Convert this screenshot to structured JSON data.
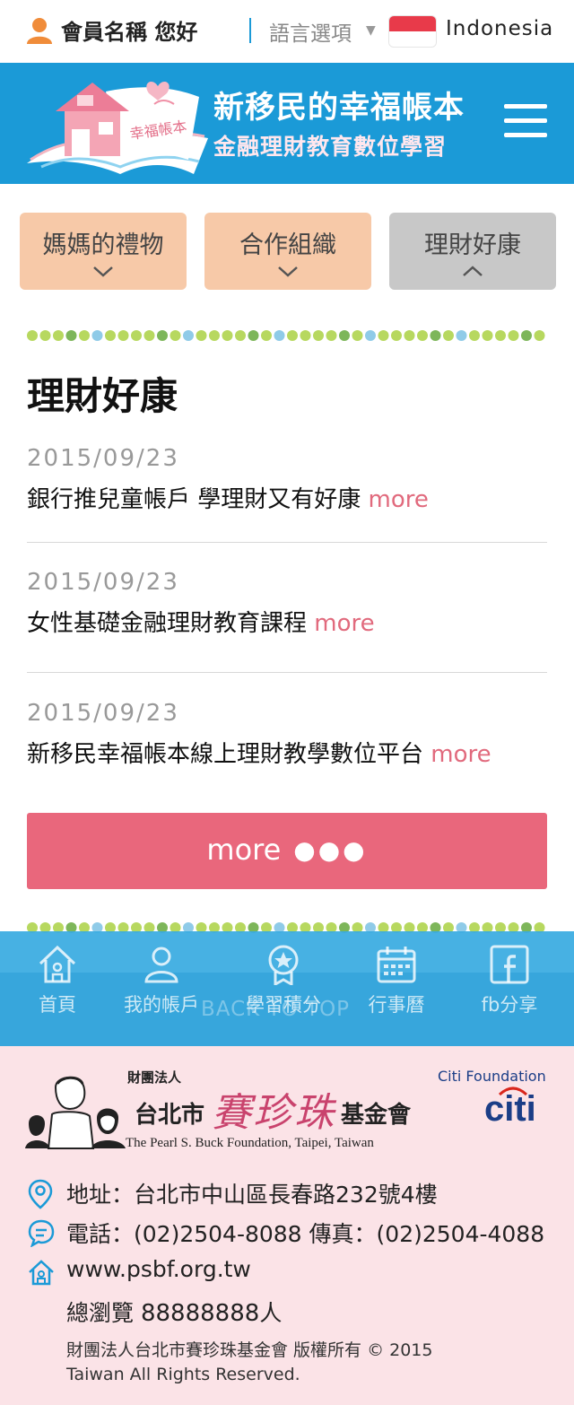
{
  "topbar": {
    "username": "會員名稱 您好",
    "language_label": "語言選項",
    "language_value": "Indonesia"
  },
  "header": {
    "title": "新移民的幸福帳本",
    "subtitle": "金融理財教育數位學習",
    "logo_text": "幸福帳本"
  },
  "tabs": [
    {
      "label": "媽媽的禮物",
      "state": "collapsed"
    },
    {
      "label": "合作組織",
      "state": "collapsed"
    },
    {
      "label": "理財好康",
      "state": "expanded"
    }
  ],
  "section": {
    "title": "理財好康",
    "more_link": "more",
    "items": [
      {
        "date": "2015/09/23",
        "title": "銀行推兒童帳戶 學理財又有好康"
      },
      {
        "date": "2015/09/23",
        "title": "女性基礎金融理財教育課程"
      },
      {
        "date": "2015/09/23",
        "title": "新移民幸福帳本線上理財教學數位平台"
      }
    ],
    "more_button": "more"
  },
  "bottom_nav": {
    "items": [
      {
        "label": "首頁",
        "icon": "home-icon"
      },
      {
        "label": "我的帳戶",
        "icon": "account-icon"
      },
      {
        "label": "學習積分",
        "icon": "badge-icon"
      },
      {
        "label": "行事曆",
        "icon": "calendar-icon"
      },
      {
        "label": "fb分享",
        "icon": "facebook-icon"
      }
    ],
    "back_to_top": "BACK TO TOP"
  },
  "footer": {
    "org_prefix": "財團法人",
    "org_city": "台北市",
    "org_name": "賽珍珠",
    "org_suffix": "基金會",
    "org_english": "The Pearl S. Buck Foundation, Taipei, Taiwan",
    "citi_foundation": "Citi Foundation",
    "citi_logo": "citi",
    "address": "地址：台北市中山區長春路232號4樓",
    "phone": "電話：(02)2504-8088   傳真：(02)2504-4088",
    "website": "www.psbf.org.tw",
    "visits_label": "總瀏覽",
    "visits_count": "88888888",
    "visits_unit": "人",
    "copyright_line1": "財團法人台北市賽珍珠基金會 版權所有 © 2015",
    "copyright_line2": "Taiwan All Rights Reserved."
  },
  "colors": {
    "brand_blue": "#1b9ad7",
    "accent_pink": "#e9677c",
    "tab_peach": "#f7c9a8",
    "tab_gray": "#c8c8c8",
    "footer_pink": "#fbe3e7",
    "user_orange": "#f08c3a"
  }
}
